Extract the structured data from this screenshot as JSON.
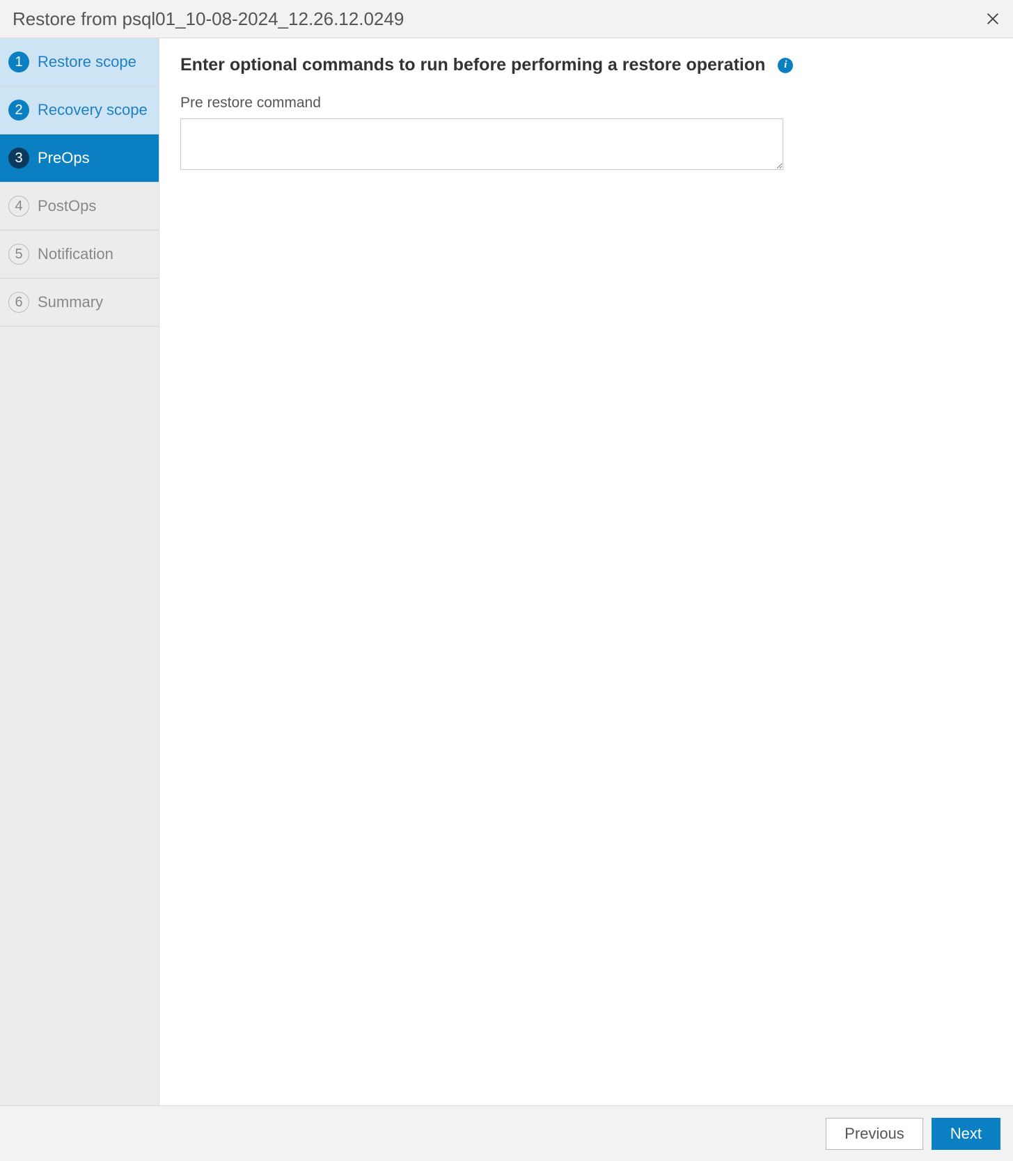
{
  "header": {
    "title": "Restore from psql01_10-08-2024_12.26.12.0249"
  },
  "sidebar": {
    "steps": [
      {
        "num": "1",
        "label": "Restore scope"
      },
      {
        "num": "2",
        "label": "Recovery scope"
      },
      {
        "num": "3",
        "label": "PreOps"
      },
      {
        "num": "4",
        "label": "PostOps"
      },
      {
        "num": "5",
        "label": "Notification"
      },
      {
        "num": "6",
        "label": "Summary"
      }
    ]
  },
  "main": {
    "heading": "Enter optional commands to run before performing a restore operation",
    "info_icon_label": "i",
    "pre_restore_label": "Pre restore command",
    "pre_restore_value": ""
  },
  "footer": {
    "previous_label": "Previous",
    "next_label": "Next"
  }
}
